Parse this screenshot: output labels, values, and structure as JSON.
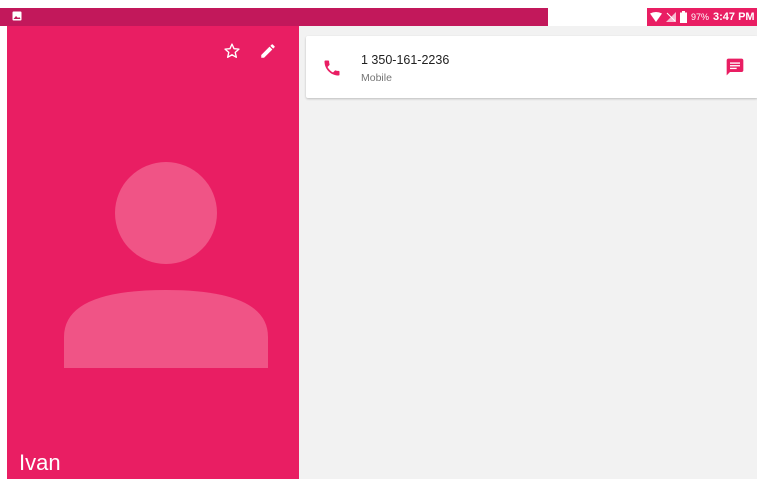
{
  "status_bar": {
    "battery_percent": "97%",
    "time": "3:47 PM",
    "icons": [
      "image-notification-icon",
      "wifi-icon",
      "signal-icon",
      "battery-icon"
    ]
  },
  "contact": {
    "name": "Ivan",
    "header_actions": [
      "star-outline-icon",
      "edit-pencil-icon"
    ]
  },
  "phone_entry": {
    "number": "1 350-161-2236",
    "type": "Mobile",
    "icons": [
      "phone-icon",
      "message-icon"
    ]
  },
  "colors": {
    "accent": "#e91e63",
    "status_bar_dark": "#c2185b",
    "avatar_silhouette": "#f05486",
    "detail_background": "#f2f2f2"
  }
}
